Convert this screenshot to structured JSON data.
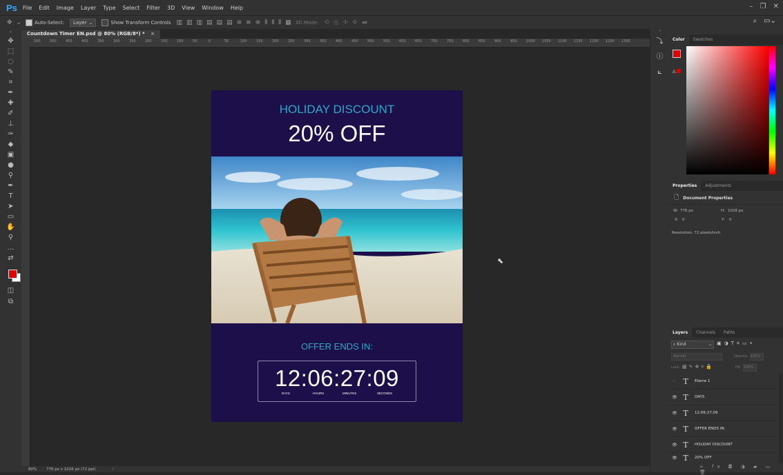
{
  "app": {
    "logo": "Ps"
  },
  "menu": [
    "File",
    "Edit",
    "Image",
    "Layer",
    "Type",
    "Select",
    "Filter",
    "3D",
    "View",
    "Window",
    "Help"
  ],
  "options": {
    "auto_select_label": "Auto-Select:",
    "auto_select_value": "Layer",
    "show_transform_label": "Show Transform Controls",
    "mode_3d": "3D Mode:"
  },
  "document": {
    "tab_title": "Countdown Timer EN.psd @ 80% (RGB/8*) *",
    "zoom": "80%",
    "status": "776 px x 1026 px (72 ppi)"
  },
  "ruler_ticks": [
    "550",
    "500",
    "450",
    "400",
    "350",
    "300",
    "250",
    "200",
    "150",
    "100",
    "50",
    "0",
    "50",
    "100",
    "150",
    "200",
    "250",
    "300",
    "350",
    "400",
    "450",
    "500",
    "550",
    "600",
    "650",
    "700",
    "750",
    "800",
    "850",
    "900",
    "950",
    "1000",
    "1050",
    "1100",
    "1150",
    "1200",
    "1250",
    "1300"
  ],
  "design": {
    "headline": "HOLIDAY DISCOUNT",
    "discount": "20% OFF",
    "offer_ends": "OFFER ENDS IN:",
    "timer": "12:06:27:09",
    "labels": {
      "days": "DAYS",
      "hours": "HOURS",
      "minutes": "MINUTES",
      "seconds": "SECONDS"
    },
    "background_color": "#1c0f4a",
    "accent_color": "#2fa8c8"
  },
  "panels": {
    "color_tabs": [
      "Color",
      "Swatches"
    ],
    "properties_tabs": [
      "Properties",
      "Adjustments"
    ],
    "properties_title": "Document Properties",
    "w_label": "W:",
    "w_value": "776 px",
    "h_label": "H:",
    "h_value": "1026 px",
    "x_label": "X:",
    "x_value": "0",
    "y_label": "Y:",
    "y_value": "0",
    "resolution": "Resolution: 72 pixels/inch",
    "layers_tabs": [
      "Layers",
      "Channels",
      "Paths"
    ],
    "kind_label": "Kind",
    "blend_mode": "Normal",
    "opacity_label": "Opacity:",
    "opacity_value": "100%",
    "lock_label": "Lock:",
    "fill_label": "Fill:",
    "fill_value": "100%",
    "layers": [
      "Ebene 1",
      "DAYS",
      "12:06:27:09",
      "OFFER ENDS IN:",
      "HOLIDAY DISCOUNT",
      "20% OFF"
    ]
  }
}
